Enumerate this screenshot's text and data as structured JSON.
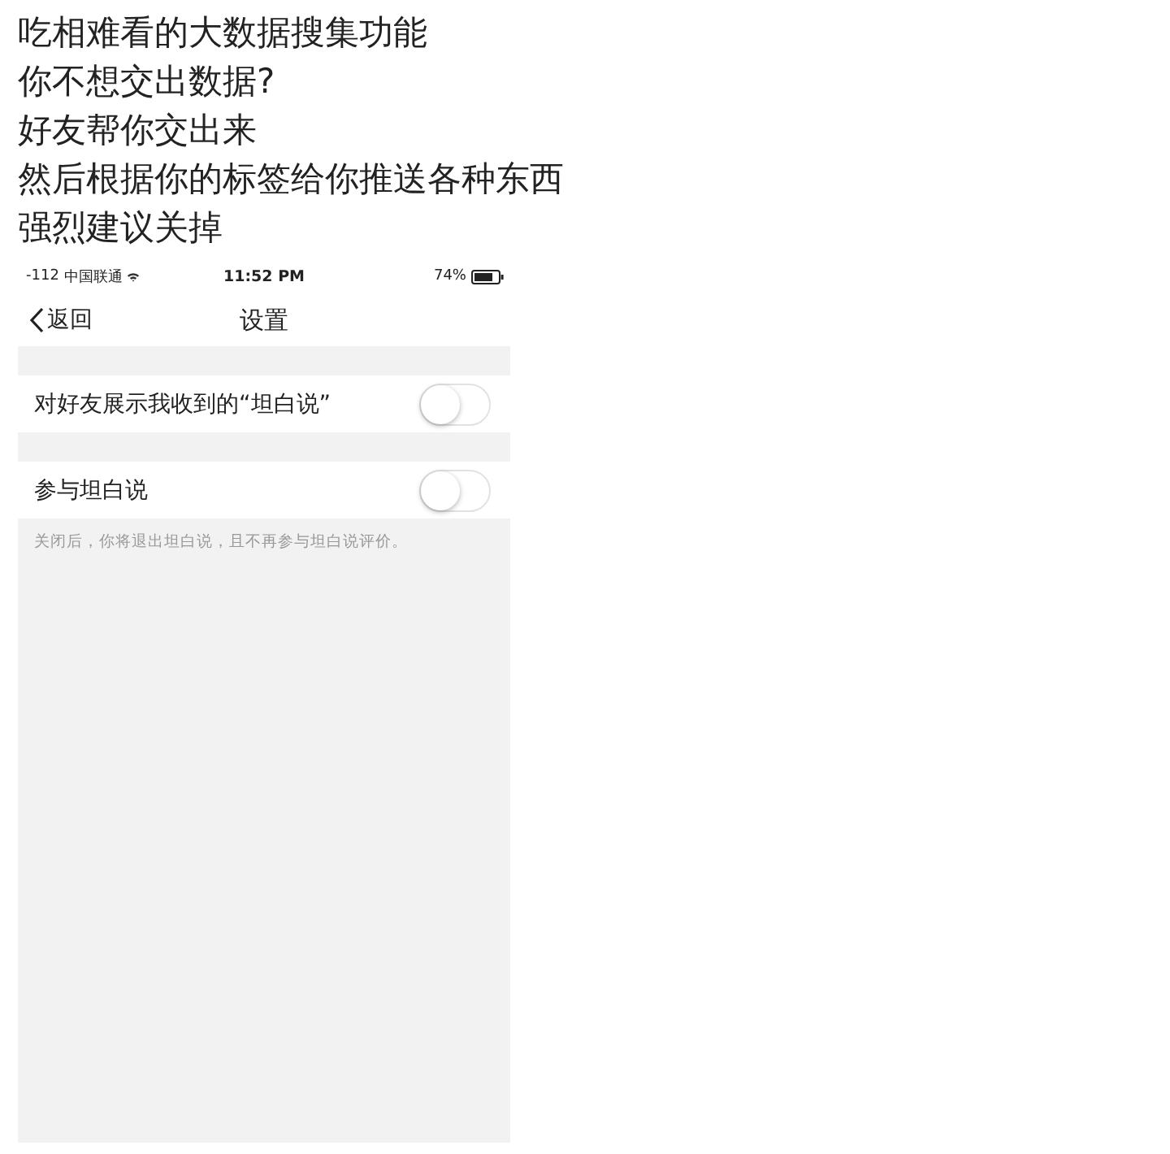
{
  "headline": {
    "lines": [
      "吃相难看的大数据搜集功能",
      "你不想交出数据?",
      "好友帮你交出来",
      "然后根据你的标签给你推送各种东西",
      "强烈建议关掉"
    ]
  },
  "status_bar": {
    "signal": "-112",
    "carrier": "中国联通",
    "time": "11:52 PM",
    "battery": "74%"
  },
  "nav_bar": {
    "back": "返回",
    "title": "设置"
  },
  "settings": [
    {
      "label": "对好友展示我收到的“坦白说”",
      "on": false
    },
    {
      "label": "参与坦白说",
      "on": false
    }
  ],
  "footnote": "关闭后，你将退出坦白说，且不再参与坦白说评价。"
}
